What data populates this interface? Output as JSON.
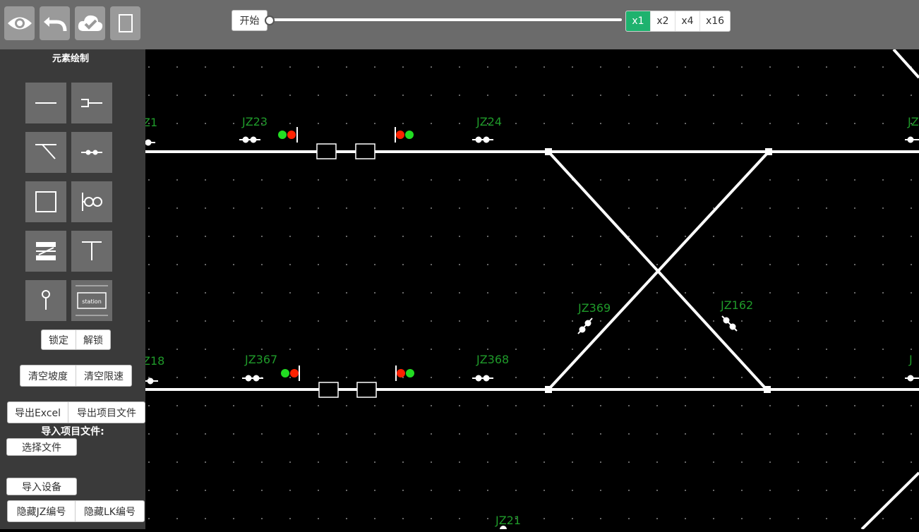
{
  "toolbar": {
    "icons": [
      "eye-icon",
      "undo-icon",
      "cloud-check-icon",
      "blank-page-icon"
    ],
    "start_label": "开始",
    "progress": 0,
    "speeds": [
      "x1",
      "x2",
      "x4",
      "x16"
    ],
    "active_speed": "x1"
  },
  "sidebar": {
    "title": "元素绘制",
    "tools": [
      "track-segment",
      "insulated-joint",
      "turnout",
      "axle-counter",
      "block-section",
      "signal-dual",
      "platform",
      "buffer-stop",
      "signal-post",
      "station"
    ],
    "station_label": "station",
    "lock_label": "锁定",
    "unlock_label": "解锁",
    "clear_grade_label": "清空坡度",
    "clear_speed_label": "清空限速",
    "export_excel_label": "导出Excel",
    "export_project_label": "导出项目文件",
    "import_project_label": "导入项目文件:",
    "choose_file_label": "选择文件",
    "import_device_label": "导入设备",
    "hide_jz_label": "隐藏JZ编号",
    "hide_lk_label": "隐藏LK编号"
  },
  "canvas": {
    "label_color": "#1f9a2a",
    "labels": [
      "Z1",
      "JZ23",
      "JZ24",
      "JZ",
      "Z18",
      "JZ367",
      "JZ368",
      "JZ369",
      "JZ162",
      "J",
      "JZ21"
    ],
    "signal_colors": {
      "green": "#22dd22",
      "red": "#ff2200"
    }
  }
}
